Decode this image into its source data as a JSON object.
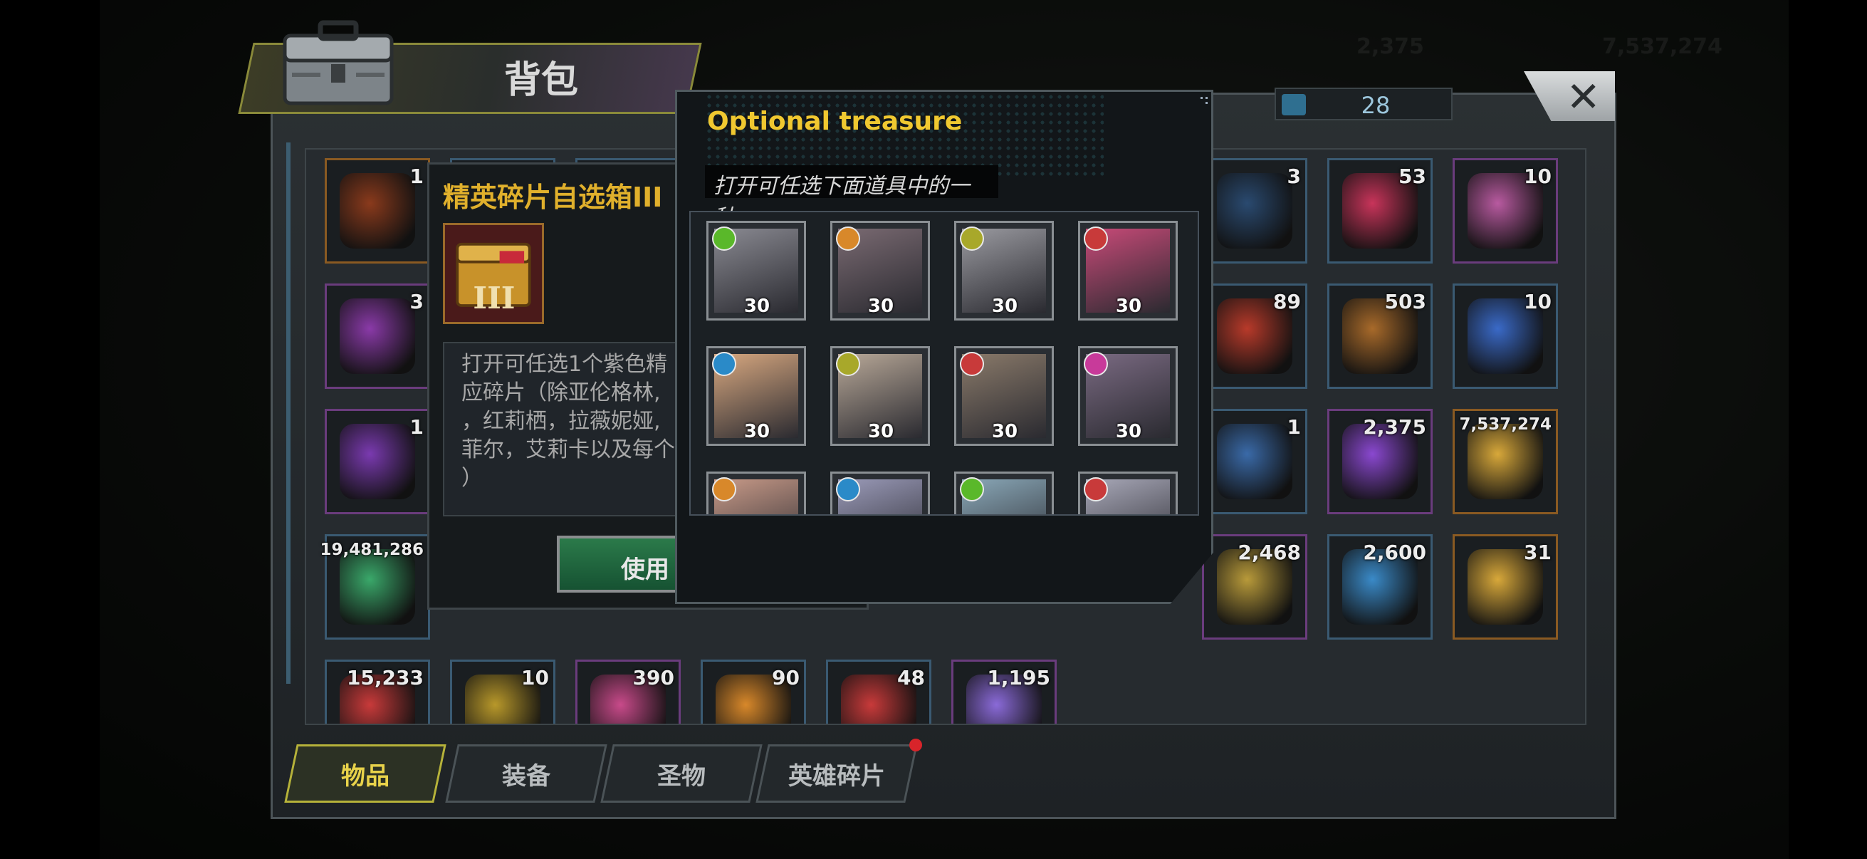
{
  "bag": {
    "title": "背包",
    "capacity_count": "28"
  },
  "background": {
    "top_stat_1": "2,375",
    "top_stat_2": "7,537,274"
  },
  "items": [
    {
      "qty": "1",
      "icon": "elite-shard-chest-icon",
      "color": "#8a3a1c"
    },
    {
      "qty": "",
      "icon": "hidden-item-icon",
      "color": "#333"
    },
    {
      "qty": "",
      "icon": "hidden-item-icon",
      "color": "#333"
    },
    {
      "qty": "",
      "icon": "hidden-item-icon",
      "color": "#333"
    },
    {
      "qty": "",
      "icon": "hidden-item-icon",
      "color": "#333"
    },
    {
      "qty": "",
      "icon": "hidden-item-icon",
      "color": "#333"
    },
    {
      "qty": "",
      "icon": "hidden-item-icon",
      "color": "#333"
    },
    {
      "qty": "3",
      "icon": "4h-speedup-token-icon",
      "color": "#2a4a70"
    },
    {
      "qty": "53",
      "icon": "lips-cap-icon",
      "color": "#c8345a"
    },
    {
      "qty": "10",
      "icon": "film-reel-icon",
      "color": "#b85aa0"
    },
    {
      "qty": "3",
      "icon": "purple-bottle-cap-icon",
      "color": "#8a3aa8"
    },
    {
      "qty": "89",
      "icon": "casino-chip-icon",
      "color": "#b83a2a"
    },
    {
      "qty": "503",
      "icon": "bullet-icon",
      "color": "#a86a2a"
    },
    {
      "qty": "10",
      "icon": "blue-glove-icon",
      "color": "#3a6ac8"
    },
    {
      "qty": "1",
      "icon": "hat-blueprint-icon",
      "color": "#7a3ab0"
    },
    {
      "qty": "1",
      "icon": "boot-blueprint-icon",
      "color": "#3a6aa8"
    },
    {
      "qty": "2,375",
      "icon": "purple-crystal-icon",
      "color": "#8a48d0"
    },
    {
      "qty": "7,537,274",
      "icon": "gold-coins-icon",
      "color": "#d8a83a"
    },
    {
      "qty": "19,481,286",
      "icon": "green-can-icon",
      "color": "#3aa86a"
    },
    {
      "qty": "2,468",
      "icon": "puzzle-piece-icon",
      "color": "#b89a3a"
    },
    {
      "qty": "2,600",
      "icon": "blue-ship-badge-icon",
      "color": "#3a8ac8"
    },
    {
      "qty": "31",
      "icon": "gold-ship-badge-icon",
      "color": "#d8a83a"
    },
    {
      "qty": "15,233",
      "icon": "red-emblem-icon",
      "color": "#c83a3a"
    },
    {
      "qty": "10",
      "icon": "lightning-medal-icon",
      "color": "#b8982a"
    },
    {
      "qty": "390",
      "icon": "pink-flower-icon",
      "color": "#c84a8a"
    },
    {
      "qty": "90",
      "icon": "orange-shield-icon",
      "color": "#d8882a"
    },
    {
      "qty": "48",
      "icon": "red-target-icon",
      "color": "#c83a3a"
    },
    {
      "qty": "1,195",
      "icon": "purple-orb-icon",
      "color": "#8a6ad8"
    }
  ],
  "tabs": [
    {
      "label": "物品",
      "active": true
    },
    {
      "label": "装备",
      "active": false
    },
    {
      "label": "圣物",
      "active": false
    },
    {
      "label": "英雄碎片",
      "active": false
    }
  ],
  "detail": {
    "title": "精英碎片自选箱III",
    "description_lines": [
      "打开可任选1个紫色精",
      "应碎片（除亚伦格林,",
      "，红莉栖，拉薇妮娅,",
      "菲尔，艾莉卡以及每个",
      "）"
    ],
    "use_label": "使用"
  },
  "popup": {
    "title": "Optional treasure",
    "subtitle": "打开可任选下面道具中的一种",
    "heroes": [
      {
        "qty": "30",
        "class_icon": "green-star-class-icon",
        "class_color": "#5ab82a",
        "face_color": "#8a8a92"
      },
      {
        "qty": "30",
        "class_icon": "orange-claw-class-icon",
        "class_color": "#d8882a",
        "face_color": "#7a6a72"
      },
      {
        "qty": "30",
        "class_icon": "olive-wing-class-icon",
        "class_color": "#a8a82a",
        "face_color": "#9a9aa0"
      },
      {
        "qty": "30",
        "class_icon": "red-target-class-icon",
        "class_color": "#c83a3a",
        "face_color": "#c84a78"
      },
      {
        "qty": "30",
        "class_icon": "blue-swirl-class-icon",
        "class_color": "#2a8ac8",
        "face_color": "#d8a880"
      },
      {
        "qty": "30",
        "class_icon": "olive-wing-class-icon",
        "class_color": "#a8a82a",
        "face_color": "#b8a898"
      },
      {
        "qty": "30",
        "class_icon": "red-target-class-icon",
        "class_color": "#c83a3a",
        "face_color": "#8a7a6a"
      },
      {
        "qty": "30",
        "class_icon": "pink-skull-class-icon",
        "class_color": "#c83a9a",
        "face_color": "#7a6a82"
      },
      {
        "qty": "",
        "class_icon": "orange-claw-class-icon",
        "class_color": "#d8882a",
        "face_color": "#c89a88"
      },
      {
        "qty": "",
        "class_icon": "blue-swirl-class-icon",
        "class_color": "#2a8ac8",
        "face_color": "#9a9ab8"
      },
      {
        "qty": "",
        "class_icon": "green-star-class-icon",
        "class_color": "#5ab82a",
        "face_color": "#8aa8b8"
      },
      {
        "qty": "",
        "class_icon": "red-target-class-icon",
        "class_color": "#c83a3a",
        "face_color": "#a8a8b8"
      }
    ]
  }
}
